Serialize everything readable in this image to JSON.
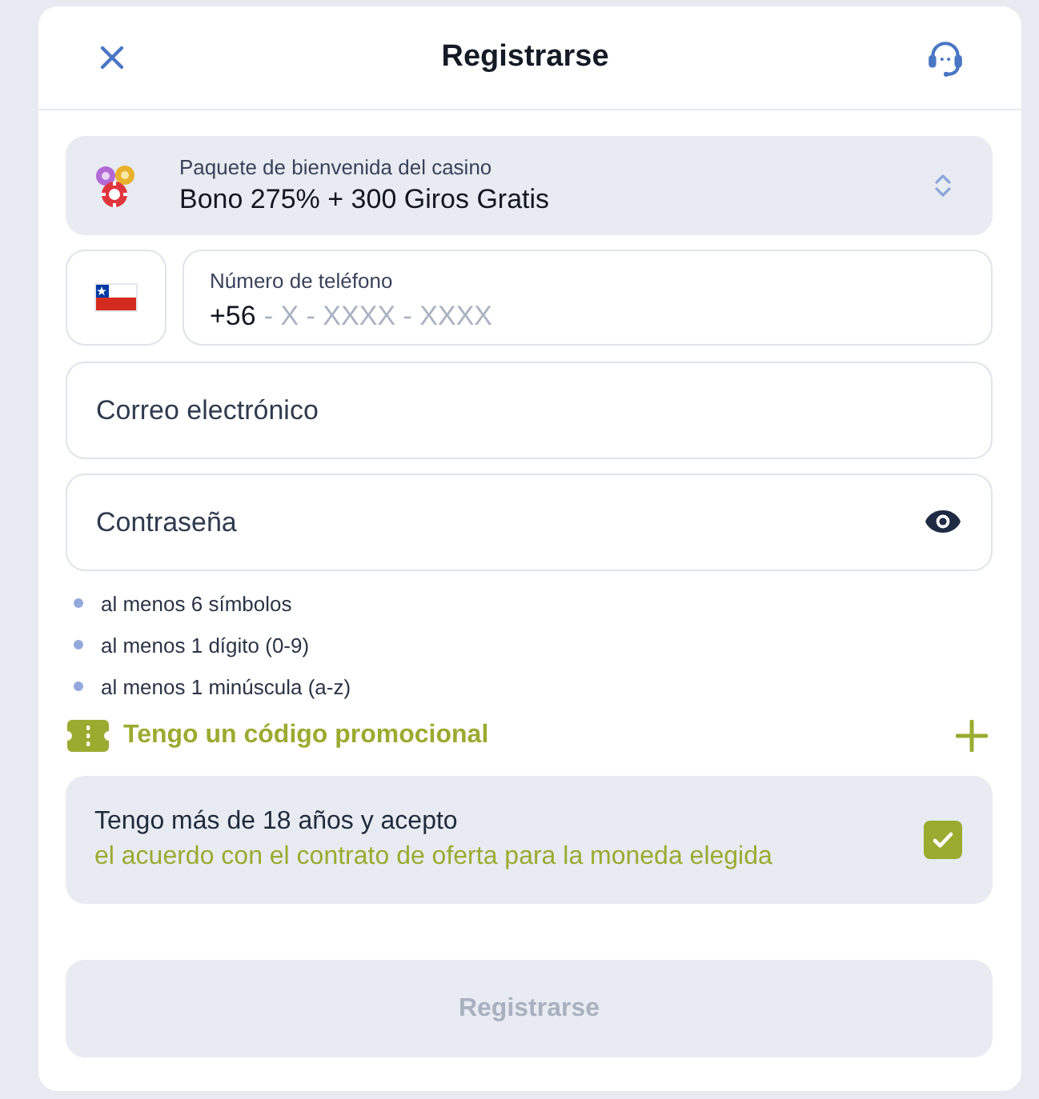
{
  "header": {
    "title": "Registrarse"
  },
  "bonus": {
    "label": "Paquete de bienvenida del casino",
    "value": "Bono 275% + 300 Giros Gratis"
  },
  "phone": {
    "label": "Número de teléfono",
    "value": "+56",
    "placeholder": "- X - XXXX - XXXX"
  },
  "email": {
    "placeholder": "Correo electrónico"
  },
  "password": {
    "placeholder": "Contraseña"
  },
  "password_rules": [
    "al menos 6 símbolos",
    "al menos 1 dígito (0-9)",
    "al menos 1 minúscula (a-z)"
  ],
  "promo": {
    "label": "Tengo un código promocional"
  },
  "terms": {
    "text": "Tengo más de 18 años y acepto",
    "link": "el acuerdo con el contrato de oferta para la moneda elegida",
    "checked": true
  },
  "submit": {
    "label": "Registrarse",
    "disabled": true
  }
}
